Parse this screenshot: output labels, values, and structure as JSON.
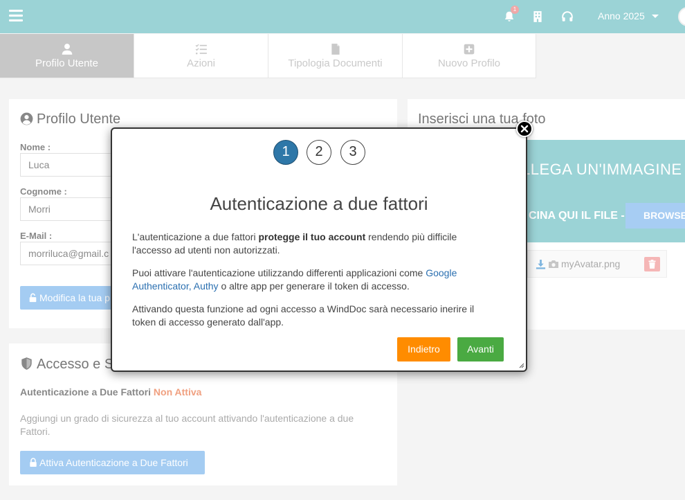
{
  "topbar": {
    "notification_count": "1",
    "year_label": "Anno 2025"
  },
  "tabs": [
    {
      "label": "Profilo Utente",
      "icon": "user-icon",
      "active": true
    },
    {
      "label": "Azioni",
      "icon": "tasks-icon",
      "active": false
    },
    {
      "label": "Tipologia Documenti",
      "icon": "document-icon",
      "active": false
    },
    {
      "label": "Nuovo Profilo",
      "icon": "plus-square-icon",
      "active": false
    }
  ],
  "profile": {
    "title": "Profilo Utente",
    "name_label": "Nome :",
    "name_value": "Luca",
    "surname_label": "Cognome :",
    "surname_value": "Morri",
    "email_label": "E-Mail :",
    "email_value": "morriluca@gmail.c",
    "edit_button": "Modifica la tua p"
  },
  "security": {
    "title": "Accesso e S",
    "twofa_label": "Autenticazione a Due Fattori",
    "twofa_status": "Non Attiva",
    "description": "Aggiungi un grado di sicurezza al tuo account attivando l'autenticazione a due Fattori.",
    "activate_button": "Attiva Autenticazione a Due Fattori"
  },
  "photo": {
    "title": "Inserisci una tua foto",
    "dropzone_title": "LLEGA UN'IMMAGINE",
    "dropzone_sub": "CINA QUI IL FILE -",
    "browse_label": "BROWSE",
    "file_name": "myAvatar.png"
  },
  "modal": {
    "steps": [
      "1",
      "2",
      "3"
    ],
    "active_step": 1,
    "title": "Autenticazione a due fattori",
    "p1_pre": "L'autenticazione a due fattori ",
    "p1_bold": "protegge il tuo account",
    "p1_post": " rendendo più difficile l'accesso ad utenti non autorizzati.",
    "p2_pre": "Puoi attivare l'autenticazione utilizzando differenti applicazioni come ",
    "p2_link1": "Google Authenticator",
    "p2_sep": ", ",
    "p2_link2": "Authy",
    "p2_post": " o altre app per generare il token di accesso.",
    "p3": "Attivando questa funzione ad ogni accesso a WindDoc sarà necessario inerire il token di accesso generato dall'app.",
    "back_button": "Indietro",
    "next_button": "Avanti"
  },
  "colors": {
    "topbar": "#9bd3d6",
    "accent_blue": "#a4ccf2",
    "back_button": "#ff8c00",
    "next_button": "#4aaa42",
    "step_active": "#2e77a8",
    "status_inactive": "#f0a080"
  }
}
